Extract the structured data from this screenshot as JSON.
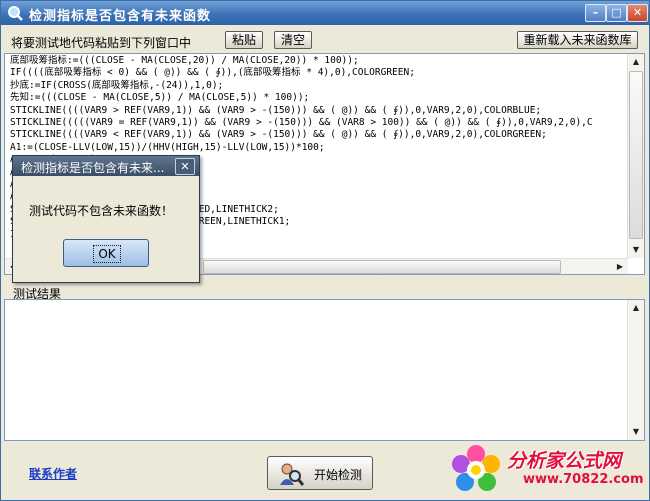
{
  "window": {
    "title": "检测指标是否包含有未来函数"
  },
  "toolbar": {
    "instruction": "将要测试地代码粘贴到下列窗口中",
    "paste_label": "粘贴",
    "clear_label": "清空",
    "reload_label": "重新载入未来函数库"
  },
  "code_lines": [
    "底部吸筹指标:=(((CLOSE - MA(CLOSE,20)) / MA(CLOSE,20)) * 100));",
    "IF((((底部吸筹指标 < 0) && ( @)) && ( ∮)),(底部吸筹指标 * 4),0),COLORGREEN;",
    "抄底:=IF(CROSS(底部吸筹指标,-(24)),1,0);",
    "先知:=(((CLOSE - MA(CLOSE,5)) / MA(CLOSE,5)) * 100));",
    "STICKLINE((((VAR9 > REF(VAR9,1)) && (VAR9 > -(150))) && ( @)) && ( ∮)),0,VAR9,2,0),COLORBLUE;",
    "STICKLINE(((((VAR9 = REF(VAR9,1)) && (VAR9 > -(150))) && (VAR8 > 100)) && ( @)) && ( ∮)),0,VAR9,2,0),C",
    "STICKLINE((((VAR9 < REF(VAR9,1)) && (VAR9 > -(150))) && ( @)) && ( ∮)),0,VAR9,2,0),COLORGREEN;",
    "A1:=(CLOSE-LLV(LOW,15))/(HHV(HIGH,15)-LLV(LOW,15))*100;",
    "A2:=SMA(A1,3,1);",
    "A3:=SMA(A2,3,1);",
    "A4:=3*A2-2*A3;",
    "A5:=MA(A4,5);",
    "STICKLINE(A4>A5,A4,A5,1,0),COLORRED,LINETHICK2;",
    "STICKLINE(A4<A5,A4,A5,1,0),COLORGREEN,LINETHICK1;",
    "IF(A4>A5,A4,DRAWNULL),COLORRED;"
  ],
  "results": {
    "label": "测试结果",
    "content": ""
  },
  "footer": {
    "contact_label": "联系作者",
    "start_label": "开始检测"
  },
  "dialog": {
    "title": "检测指标是否包含有未来...",
    "message": "测试代码不包含未来函数！",
    "ok_label": "OK",
    "close_glyph": "✕"
  },
  "logo": {
    "name": "分析家公式网",
    "url": "www.70822.com"
  },
  "icons": {
    "minimize": "–",
    "maximize": "□",
    "close": "✕",
    "arrow_up": "▲",
    "arrow_down": "▼",
    "arrow_left": "◀",
    "arrow_right": "▶"
  },
  "colors": {
    "titlebar": "#3e73b7",
    "link": "#1a3cc8",
    "logo_text": "#e0103c"
  }
}
